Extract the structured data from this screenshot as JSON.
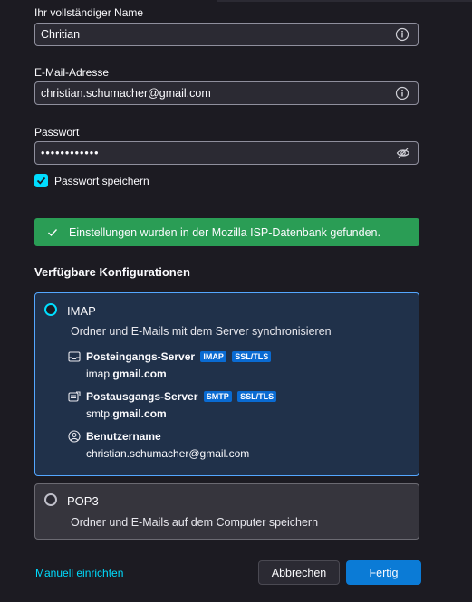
{
  "form": {
    "name_label": "Ihr vollständiger Name",
    "name_value": "Chritian",
    "email_label": "E-Mail-Adresse",
    "email_value": "christian.schumacher@gmail.com",
    "password_label": "Passwort",
    "password_value": "••••••••••••",
    "remember_label": "Passwort speichern",
    "remember_checked": true
  },
  "status": {
    "message": "Einstellungen wurden in der Mozilla ISP-Datenbank gefunden.",
    "icon": "checkmark-icon"
  },
  "configs": {
    "title": "Verfügbare Konfigurationen",
    "imap": {
      "label": "IMAP",
      "description": "Ordner und E-Mails mit dem Server synchronisieren",
      "selected": true,
      "incoming_title": "Posteingangs-Server",
      "incoming_badges": [
        "IMAP",
        "SSL/TLS"
      ],
      "incoming_host_prefix": "imap.",
      "incoming_host_bold": "gmail.com",
      "outgoing_title": "Postausgangs-Server",
      "outgoing_badges": [
        "SMTP",
        "SSL/TLS"
      ],
      "outgoing_host_prefix": "smtp.",
      "outgoing_host_bold": "gmail.com",
      "username_title": "Benutzername",
      "username_value": "christian.schumacher@gmail.com"
    },
    "pop3": {
      "label": "POP3",
      "description": "Ordner und E-Mails auf dem Computer speichern",
      "selected": false
    }
  },
  "footer": {
    "manual_link": "Manuell einrichten",
    "cancel_label": "Abbrechen",
    "done_label": "Fertig"
  },
  "colors": {
    "background": "#1c1b22",
    "accent": "#00ddff",
    "success": "#2a9d55",
    "primary_button": "#0b7bd6",
    "badge": "#0a6bd2"
  }
}
